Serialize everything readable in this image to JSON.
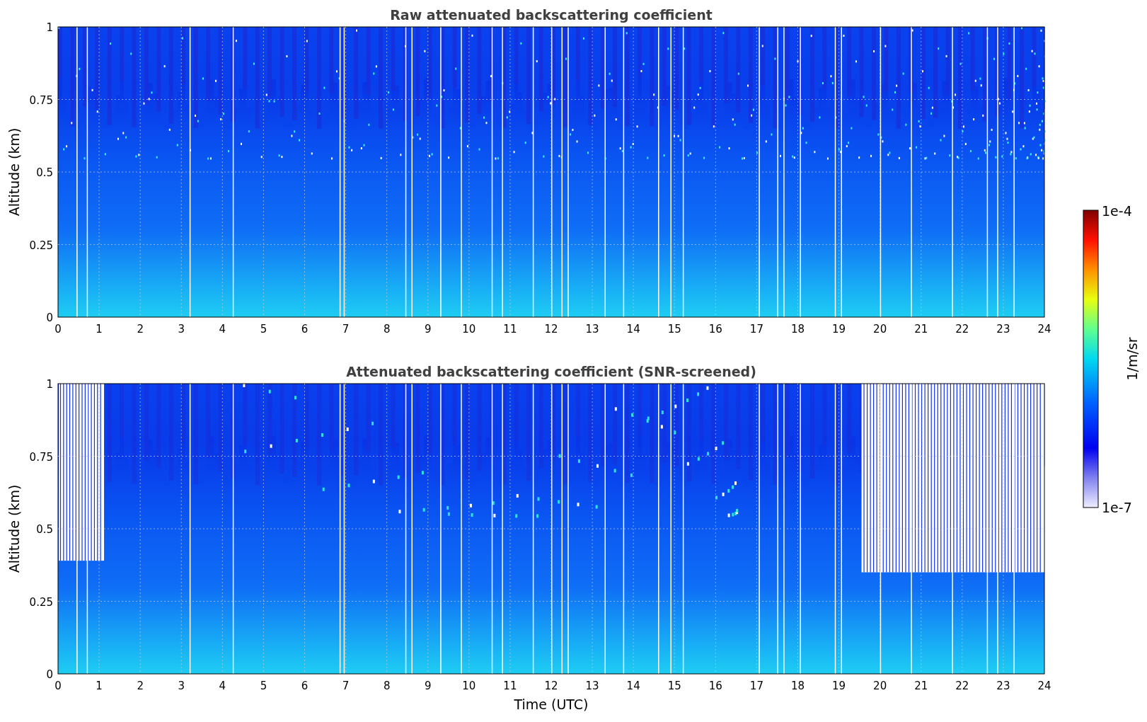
{
  "panels": [
    {
      "title": "Raw attenuated backscattering coefficient",
      "ylabel": "Altitude (km)",
      "yticks": [
        "1",
        "0.75",
        "0.5",
        "0.25",
        "0"
      ],
      "xticks": [
        "0",
        "1",
        "2",
        "3",
        "4",
        "5",
        "6",
        "7",
        "8",
        "9",
        "10",
        "11",
        "12",
        "13",
        "14",
        "15",
        "16",
        "17",
        "18",
        "19",
        "20",
        "21",
        "22",
        "23",
        "24"
      ],
      "screened": false
    },
    {
      "title": "Attenuated backscattering coefficient (SNR-screened)",
      "ylabel": "Altitude (km)",
      "yticks": [
        "1",
        "0.75",
        "0.5",
        "0.25",
        "0"
      ],
      "xticks": [
        "0",
        "1",
        "2",
        "3",
        "4",
        "5",
        "6",
        "7",
        "8",
        "9",
        "10",
        "11",
        "12",
        "13",
        "14",
        "15",
        "16",
        "17",
        "18",
        "19",
        "20",
        "21",
        "22",
        "23",
        "24"
      ],
      "xlabel": "Time (UTC)",
      "screened": true
    }
  ],
  "colorbar": {
    "max_label": "1e-4",
    "min_label": "1e-7",
    "label": "1/m/sr"
  }
}
